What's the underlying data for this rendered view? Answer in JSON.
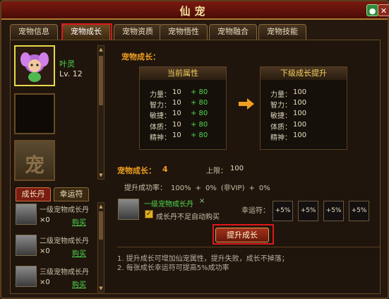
{
  "window": {
    "title": "仙宠"
  },
  "tabs": [
    {
      "label": "宠物信息",
      "active": false
    },
    {
      "label": "宠物成长",
      "active": true
    },
    {
      "label": "宠物资质",
      "active": false
    },
    {
      "label": "宠物悟性",
      "active": false
    },
    {
      "label": "宠物融合",
      "active": false
    },
    {
      "label": "宠物技能",
      "active": false
    }
  ],
  "pet": {
    "name": "叶灵",
    "level": "Lv. 12",
    "slot3_icon": "宠"
  },
  "subtabs": [
    "成长丹",
    "幸运符"
  ],
  "items": [
    {
      "name": "一级宠物成长丹",
      "count": "×0",
      "buy": "购买"
    },
    {
      "name": "二级宠物成长丹",
      "count": "×0",
      "buy": "购买"
    },
    {
      "name": "三级宠物成长丹",
      "count": "×0",
      "buy": "购买"
    }
  ],
  "section": {
    "title": "宠物成长："
  },
  "current": {
    "header": "当前属性",
    "rows": [
      {
        "label": "力量：",
        "value": "10",
        "add": "+ 80"
      },
      {
        "label": "智力：",
        "value": "10",
        "add": "+ 80"
      },
      {
        "label": "敏捷：",
        "value": "10",
        "add": "+ 80"
      },
      {
        "label": "体质：",
        "value": "10",
        "add": "+ 80"
      },
      {
        "label": "精神：",
        "value": "10",
        "add": "+ 80"
      }
    ]
  },
  "next": {
    "header": "下级成长提升",
    "rows": [
      {
        "label": "力量：",
        "value": "100"
      },
      {
        "label": "智力：",
        "value": "100"
      },
      {
        "label": "敏捷：",
        "value": "100"
      },
      {
        "label": "体质：",
        "value": "100"
      },
      {
        "label": "精神：",
        "value": "100"
      }
    ]
  },
  "growth": {
    "label": "宠物成长：",
    "value": "4",
    "limit_label": "上限：",
    "limit_value": "100"
  },
  "rate": {
    "label": "提升成功率：",
    "base": "100%",
    "plus1": "+",
    "value2": "0%",
    "novip": "(非VIP)",
    "plus2": "+",
    "value3": "0%"
  },
  "selected_item": {
    "name": "一级宠物成长丹",
    "x": "×",
    "auto_label": "成长丹不足自动购买",
    "auto_checked": true
  },
  "luck": {
    "label": "幸运符：",
    "slots": [
      "+5%",
      "+5%",
      "+5%",
      "+5%"
    ]
  },
  "upgrade_button": "提升成长",
  "notes": [
    "1. 提升成长可增加仙宠属性，提升失败，成长不掉落；",
    "2. 每张成长幸运符可提高5%成功率"
  ],
  "colors": {
    "accent_orange": "#f0a020",
    "green": "#4fd84f",
    "highlight_red": "#e0161b"
  }
}
